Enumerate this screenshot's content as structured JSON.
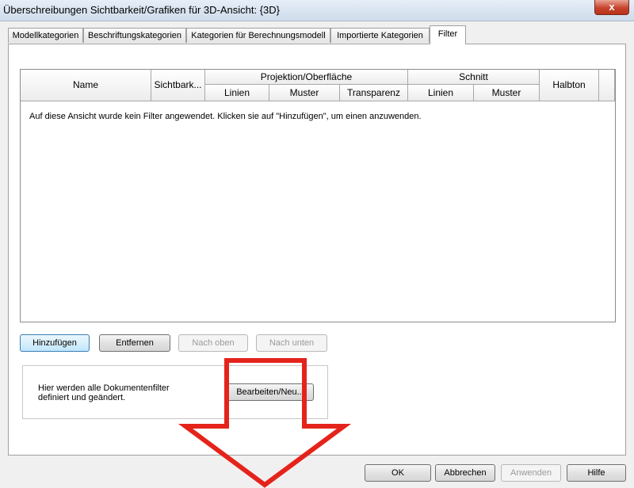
{
  "window": {
    "title": "Überschreibungen Sichtbarkeit/Grafiken für 3D-Ansicht: {3D}",
    "close_glyph": "x"
  },
  "tabs": [
    {
      "label": "Modellkategorien"
    },
    {
      "label": "Beschriftungskategorien"
    },
    {
      "label": "Kategorien für Berechnungsmodell"
    },
    {
      "label": "Importierte Kategorien"
    },
    {
      "label": "Filter",
      "active": true
    }
  ],
  "table": {
    "headers": {
      "name": "Name",
      "visibility": "Sichtbark...",
      "projection_group": "Projektion/Oberfläche",
      "projection_lines": "Linien",
      "projection_pattern": "Muster",
      "projection_transparency": "Transparenz",
      "cut_group": "Schnitt",
      "cut_lines": "Linien",
      "cut_pattern": "Muster",
      "halftone": "Halbton"
    },
    "empty_message": "Auf diese Ansicht wurde kein Filter angewendet. Klicken sie auf \"Hinzufügen\", um einen anzuwenden."
  },
  "actions": {
    "add": "Hinzufügen",
    "remove": "Entfernen",
    "move_up": "Nach oben",
    "move_down": "Nach unten"
  },
  "document_filters": {
    "description": "Hier werden alle Dokumentenfilter definiert und geändert.",
    "edit_button": "Bearbeiten/Neu..."
  },
  "footer": {
    "ok": "OK",
    "cancel": "Abbrechen",
    "apply": "Anwenden",
    "help": "Hilfe"
  },
  "colors": {
    "annotation_arrow": "#e4241b",
    "focus_border": "#3c7fb1"
  },
  "icons": {
    "annotation": "down-arrow-icon"
  }
}
